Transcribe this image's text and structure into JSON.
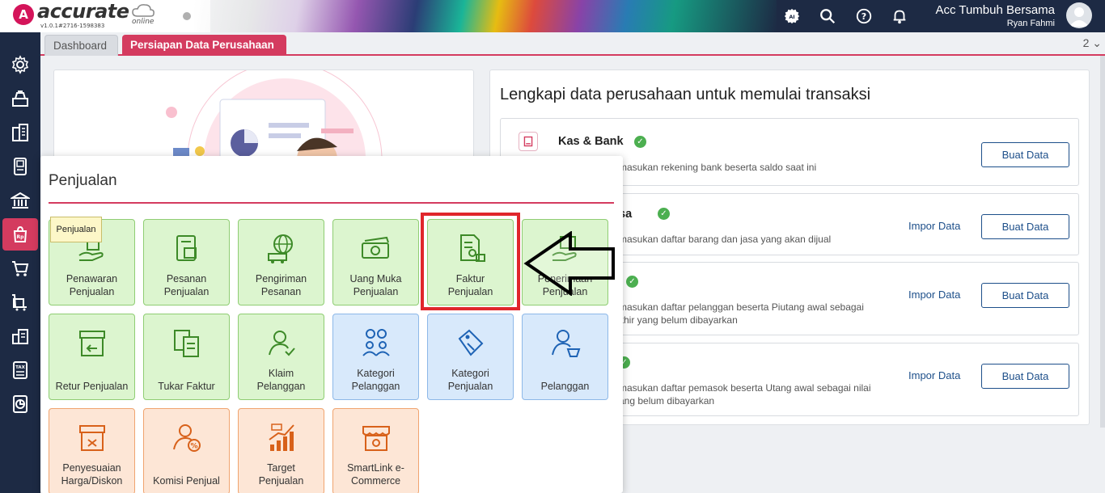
{
  "app": {
    "logo_text": "accurate",
    "logo_sub": "online",
    "version": "v1.0.1#2716-1598383",
    "company_name": "Acc Tumbuh Bersama",
    "user_name": "Ryan Fahmi"
  },
  "tabs": {
    "dashboard": "Dashboard",
    "persiapan": "Persiapan Data Perusahaan",
    "count": "2 ⌄"
  },
  "sidebar": {
    "tooltip": "Penjualan",
    "items": [
      "gear-icon",
      "cash-register-icon",
      "building-icon",
      "ledger-icon",
      "bank-icon",
      "sales-bag-icon",
      "cart-icon",
      "purchase-icon",
      "warehouse-icon",
      "tax-icon",
      "report-icon"
    ]
  },
  "setup": {
    "title": "Lengkapi data perusahaan untuk memulai transaksi",
    "rows": [
      {
        "title": "Kas & Bank",
        "desc1": "masukan rekening bank beserta saldo saat ini",
        "desc2": "",
        "impor": "",
        "buat": "Buat Data"
      },
      {
        "title": "sa",
        "desc1": "masukan daftar barang dan jasa yang akan dijual",
        "desc2": "",
        "impor": "Impor Data",
        "buat": "Buat Data"
      },
      {
        "title": "",
        "desc1": "masukan daftar pelanggan beserta Piutang awal sebagai",
        "desc2": "khir yang belum dibayarkan",
        "impor": "Impor Data",
        "buat": "Buat Data"
      },
      {
        "title": "",
        "desc1": "masukan daftar pemasok beserta Utang awal sebagai nilai",
        "desc2": "ang belum dibayarkan",
        "impor": "Impor Data",
        "buat": "Buat Data"
      }
    ]
  },
  "popup": {
    "title": "Penjualan",
    "tiles": [
      {
        "l1": "Penawaran",
        "l2": "Penjualan"
      },
      {
        "l1": "Pesanan",
        "l2": "Penjualan"
      },
      {
        "l1": "Pengiriman",
        "l2": "Pesanan"
      },
      {
        "l1": "Uang Muka",
        "l2": "Penjualan"
      },
      {
        "l1": "Faktur",
        "l2": "Penjualan"
      },
      {
        "l1": "Penerimaan",
        "l2": "Penjualan"
      },
      {
        "l1": "Retur Penjualan",
        "l2": ""
      },
      {
        "l1": "Tukar Faktur",
        "l2": ""
      },
      {
        "l1": "Klaim",
        "l2": "Pelanggan"
      },
      {
        "l1": "Kategori",
        "l2": "Pelanggan"
      },
      {
        "l1": "Kategori",
        "l2": "Penjualan"
      },
      {
        "l1": "Pelanggan",
        "l2": ""
      },
      {
        "l1": "Penyesuaian",
        "l2": "Harga/Diskon"
      },
      {
        "l1": "Komisi Penjual",
        "l2": ""
      },
      {
        "l1": "Target",
        "l2": "Penjualan"
      },
      {
        "l1": "SmartLink e-",
        "l2": "Commerce"
      }
    ]
  },
  "colors": {
    "accent": "#d43b5f",
    "sidebar": "#1d2a44",
    "tile_green": "#dcf5cf",
    "tile_blue": "#d8e9fb",
    "tile_orange": "#fde6d6",
    "highlight": "#e0262c"
  }
}
